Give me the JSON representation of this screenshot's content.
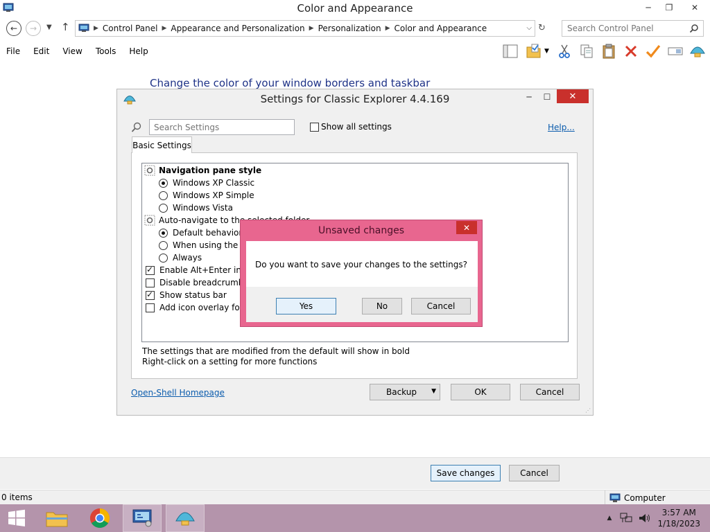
{
  "window": {
    "title": "Color and Appearance",
    "controls": {
      "minimize": "─",
      "restore": "❐",
      "close": "✕"
    }
  },
  "address": {
    "breadcrumbs": [
      "Control Panel",
      "Appearance and Personalization",
      "Personalization",
      "Color and Appearance"
    ],
    "search_placeholder": "Search Control Panel"
  },
  "menu": {
    "items": [
      "File",
      "Edit",
      "View",
      "Tools",
      "Help"
    ]
  },
  "toolbar": {
    "icons": [
      "layout-icon",
      "folder-checked-icon",
      "cut-icon",
      "copy-icon",
      "paste-icon",
      "delete-icon",
      "properties-check-icon",
      "rename-icon",
      "shell-icon"
    ]
  },
  "content": {
    "heading": "Change the color of your window borders and taskbar"
  },
  "footer": {
    "save_label": "Save changes",
    "cancel_label": "Cancel"
  },
  "status": {
    "items_count": "0 items",
    "location": "Computer"
  },
  "taskbar": {
    "apps": [
      "start-button",
      "file-explorer-icon",
      "chrome-icon",
      "control-panel-icon",
      "open-shell-icon"
    ],
    "clock_time": "3:57 AM",
    "clock_date": "1/18/2023"
  },
  "settings_dialog": {
    "title": "Settings for Classic Explorer 4.4.169",
    "search_placeholder": "Search Settings",
    "show_all_label": "Show all settings",
    "help_link": "Help...",
    "tab_label": "Basic Settings",
    "items": [
      {
        "type": "group",
        "label": "Navigation pane style",
        "bold": true
      },
      {
        "type": "radio",
        "label": "Windows XP Classic",
        "checked": true
      },
      {
        "type": "radio",
        "label": "Windows XP Simple",
        "checked": false
      },
      {
        "type": "radio",
        "label": "Windows Vista",
        "checked": false
      },
      {
        "type": "group",
        "label": "Auto-navigate to the selected folder",
        "bold": false
      },
      {
        "type": "radio",
        "label": "Default behavior",
        "checked": true
      },
      {
        "type": "radio",
        "label": "When using the ke",
        "checked": false
      },
      {
        "type": "radio",
        "label": "Always",
        "checked": false
      },
      {
        "type": "check",
        "label": "Enable Alt+Enter in the",
        "checked": true
      },
      {
        "type": "check",
        "label": "Disable breadcrumbs",
        "checked": false
      },
      {
        "type": "check",
        "label": "Show status bar",
        "checked": true
      },
      {
        "type": "check",
        "label": "Add icon overlay for sh",
        "checked": false
      }
    ],
    "note_line1": "The settings that are modified from the default will show in bold",
    "note_line2": "Right-click on a setting for more functions",
    "homepage_link": "Open-Shell Homepage",
    "backup_label": "Backup",
    "ok_label": "OK",
    "cancel_label": "Cancel"
  },
  "unsaved_dialog": {
    "title": "Unsaved changes",
    "message": "Do you want to save your changes to the settings?",
    "yes_label": "Yes",
    "no_label": "No",
    "cancel_label": "Cancel"
  }
}
